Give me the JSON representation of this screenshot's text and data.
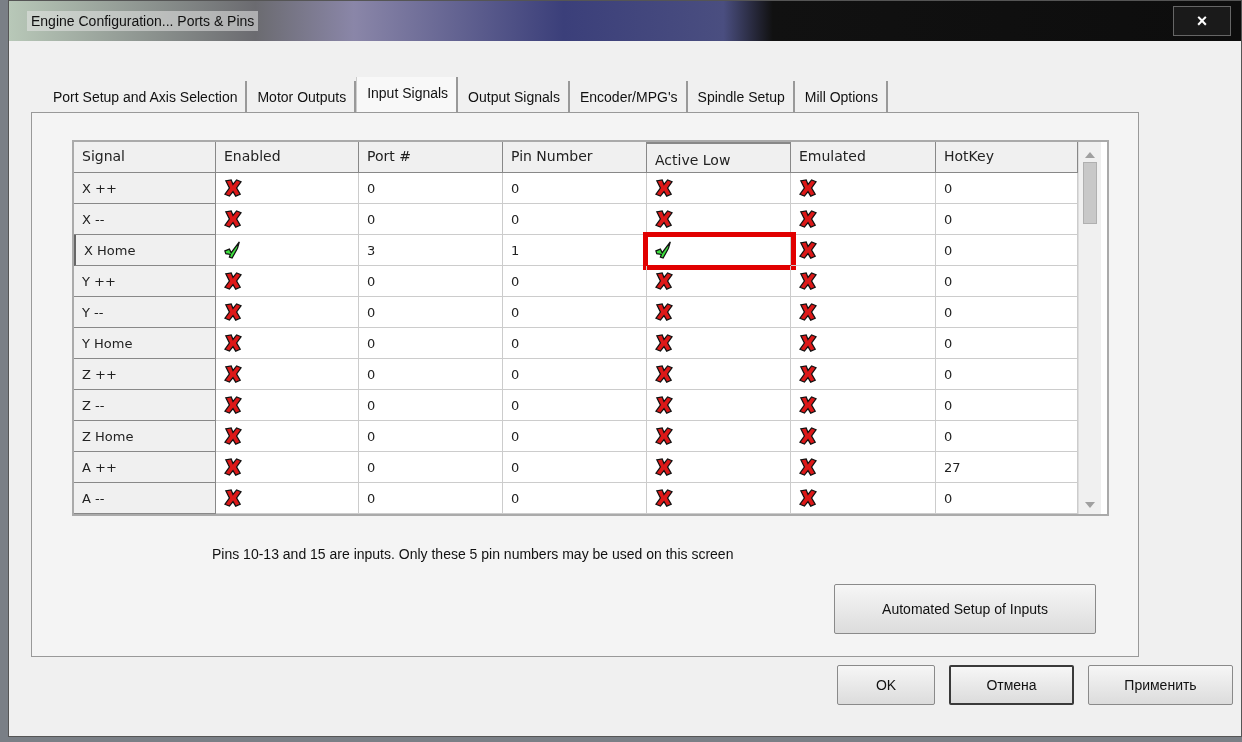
{
  "window": {
    "title": "Engine Configuration... Ports & Pins",
    "close": "×"
  },
  "tabs": [
    {
      "label": "Port Setup and Axis Selection",
      "selected": false
    },
    {
      "label": "Motor Outputs",
      "selected": false
    },
    {
      "label": "Input Signals",
      "selected": true
    },
    {
      "label": "Output Signals",
      "selected": false
    },
    {
      "label": "Encoder/MPG's",
      "selected": false
    },
    {
      "label": "Spindle Setup",
      "selected": false
    },
    {
      "label": "Mill Options",
      "selected": false
    }
  ],
  "table": {
    "columns": [
      "Signal",
      "Enabled",
      "Port #",
      "Pin Number",
      "Active Low",
      "Emulated",
      "HotKey"
    ],
    "rows": [
      {
        "signal": "X ++",
        "enabled": false,
        "port": "0",
        "pin": "0",
        "active_low": false,
        "emulated": false,
        "hotkey": "0",
        "highlighted": false
      },
      {
        "signal": "X --",
        "enabled": false,
        "port": "0",
        "pin": "0",
        "active_low": false,
        "emulated": false,
        "hotkey": "0",
        "highlighted": false
      },
      {
        "signal": "X Home",
        "enabled": true,
        "port": "3",
        "pin": "1",
        "active_low": true,
        "emulated": false,
        "hotkey": "0",
        "highlighted": true
      },
      {
        "signal": "Y ++",
        "enabled": false,
        "port": "0",
        "pin": "0",
        "active_low": false,
        "emulated": false,
        "hotkey": "0",
        "highlighted": false
      },
      {
        "signal": "Y --",
        "enabled": false,
        "port": "0",
        "pin": "0",
        "active_low": false,
        "emulated": false,
        "hotkey": "0",
        "highlighted": false
      },
      {
        "signal": "Y Home",
        "enabled": false,
        "port": "0",
        "pin": "0",
        "active_low": false,
        "emulated": false,
        "hotkey": "0",
        "highlighted": false
      },
      {
        "signal": "Z ++",
        "enabled": false,
        "port": "0",
        "pin": "0",
        "active_low": false,
        "emulated": false,
        "hotkey": "0",
        "highlighted": false
      },
      {
        "signal": "Z --",
        "enabled": false,
        "port": "0",
        "pin": "0",
        "active_low": false,
        "emulated": false,
        "hotkey": "0",
        "highlighted": false
      },
      {
        "signal": "Z Home",
        "enabled": false,
        "port": "0",
        "pin": "0",
        "active_low": false,
        "emulated": false,
        "hotkey": "0",
        "highlighted": false
      },
      {
        "signal": "A ++",
        "enabled": false,
        "port": "0",
        "pin": "0",
        "active_low": false,
        "emulated": false,
        "hotkey": "27",
        "highlighted": false
      },
      {
        "signal": "A --",
        "enabled": false,
        "port": "0",
        "pin": "0",
        "active_low": false,
        "emulated": false,
        "hotkey": "0",
        "highlighted": false
      }
    ]
  },
  "note": "Pins 10-13 and 15 are inputs. Only these 5 pin numbers may be used on this screen",
  "setup_button": "Automated Setup of Inputs",
  "buttons": [
    "OK",
    "Отмена",
    "Применить"
  ]
}
